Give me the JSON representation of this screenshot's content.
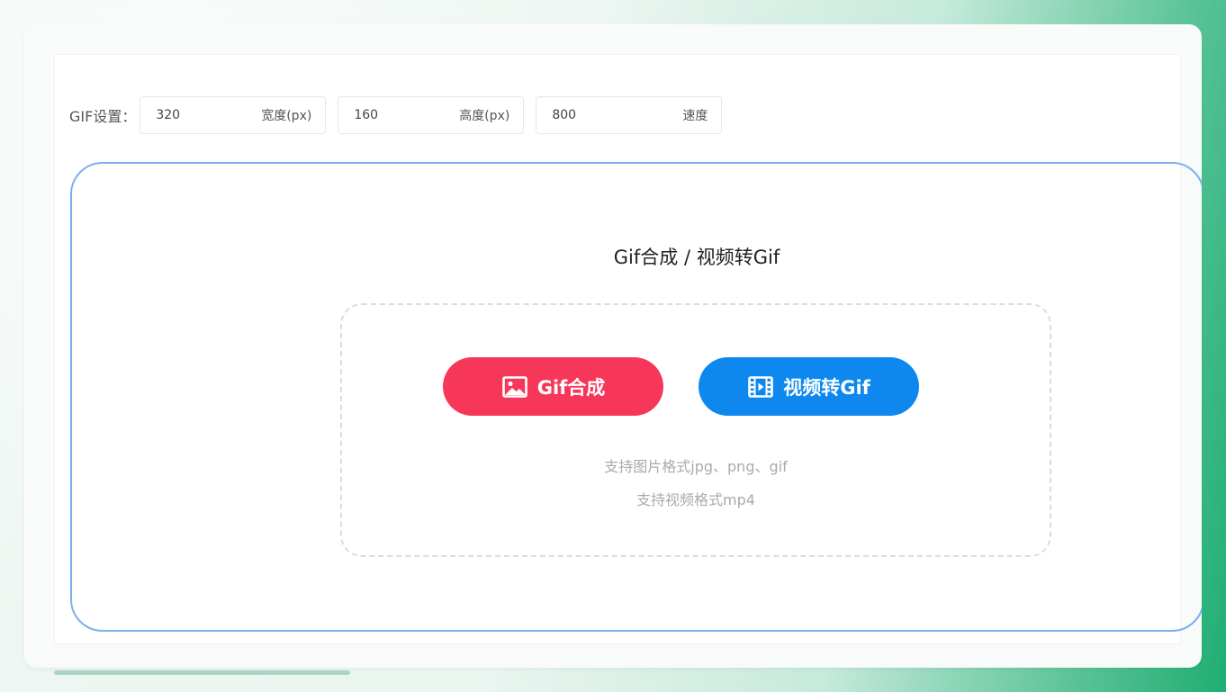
{
  "settings": {
    "label": "GIF设置：",
    "fields": [
      {
        "value": "320",
        "suffix": "宽度(px)"
      },
      {
        "value": "160",
        "suffix": "高度(px)"
      },
      {
        "value": "800",
        "suffix": "速度"
      }
    ]
  },
  "main": {
    "title": "Gif合成 / 视频转Gif",
    "buttons": {
      "gif_compose": "Gif合成",
      "video_to_gif": "视频转Gif"
    },
    "hints": {
      "image_formats": "支持图片格式jpg、png、gif",
      "video_formats": "支持视频格式mp4"
    }
  },
  "colors": {
    "gif_button": "#f7375a",
    "video_button": "#0e88ee",
    "zone_border": "#7cb0ef"
  },
  "icons": {
    "gif_button": "image-icon",
    "video_button": "video-film-icon"
  }
}
